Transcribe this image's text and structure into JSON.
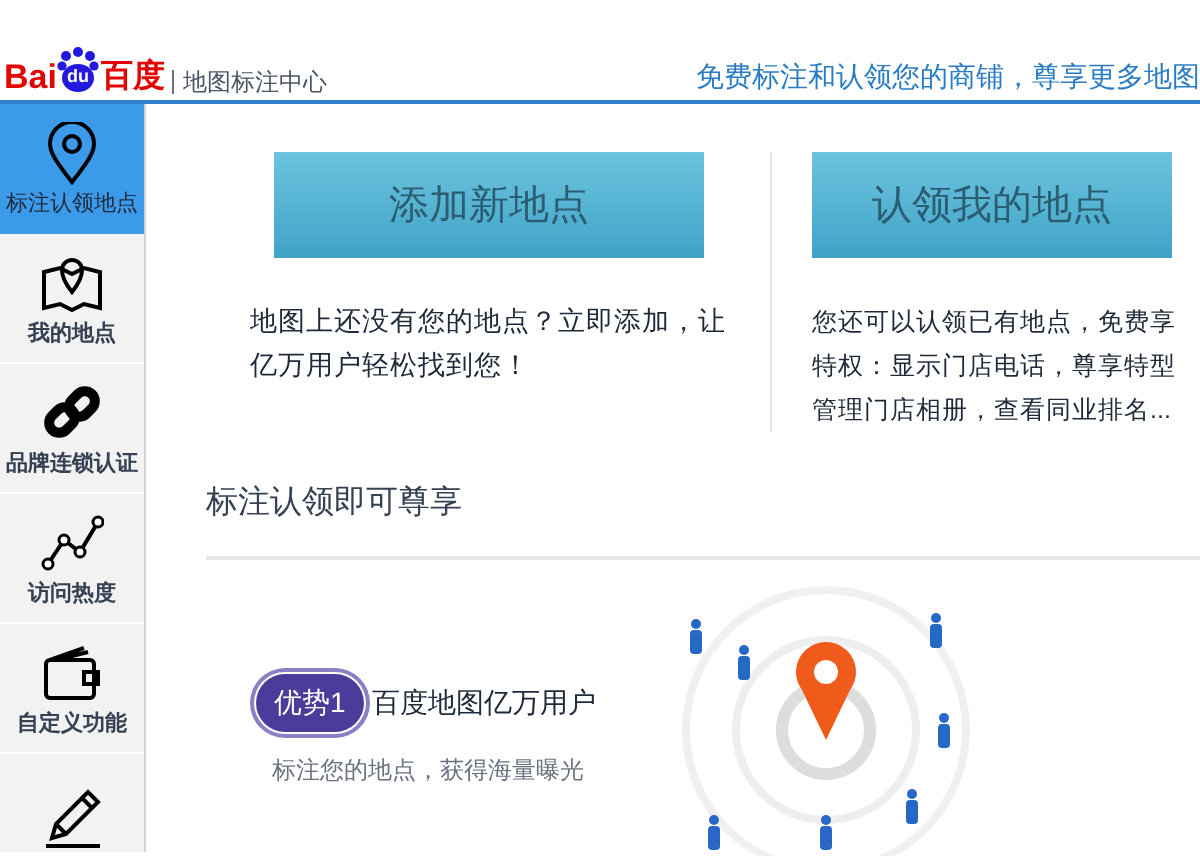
{
  "header": {
    "logo_text": "Bai",
    "logo_paw": "du",
    "logo_cn": "百度",
    "subtitle": "地图标注中心",
    "slogan": "免费标注和认领您的商铺，尊享更多地图"
  },
  "sidebar": {
    "items": [
      {
        "kind": "pin",
        "label": "标注认领地点",
        "selected": true
      },
      {
        "kind": "map",
        "label": "我的地点",
        "selected": false
      },
      {
        "kind": "link",
        "label": "品牌连锁认证",
        "selected": false
      },
      {
        "kind": "trend",
        "label": "访问热度",
        "selected": false
      },
      {
        "kind": "wallet",
        "label": "自定义功能",
        "selected": false
      },
      {
        "kind": "pencil",
        "selected": false
      }
    ]
  },
  "actions": [
    {
      "button": "添加新地点",
      "description": [
        "地图上还没有您的地点？立即添加，让",
        "亿万用户轻松找到您！"
      ]
    },
    {
      "button": "认领我的地点",
      "description": [
        "您还可以认领已有地点，免费享",
        "特权：显示门店电话，尊享特型",
        "管理门店相册，查看同业排名..."
      ]
    }
  ],
  "benefits": {
    "title": "标注认领即可尊享",
    "items": [
      {
        "badge": "优势1",
        "title": "百度地图亿万用户",
        "description": "标注您的地点，获得海量曝光"
      }
    ]
  }
}
